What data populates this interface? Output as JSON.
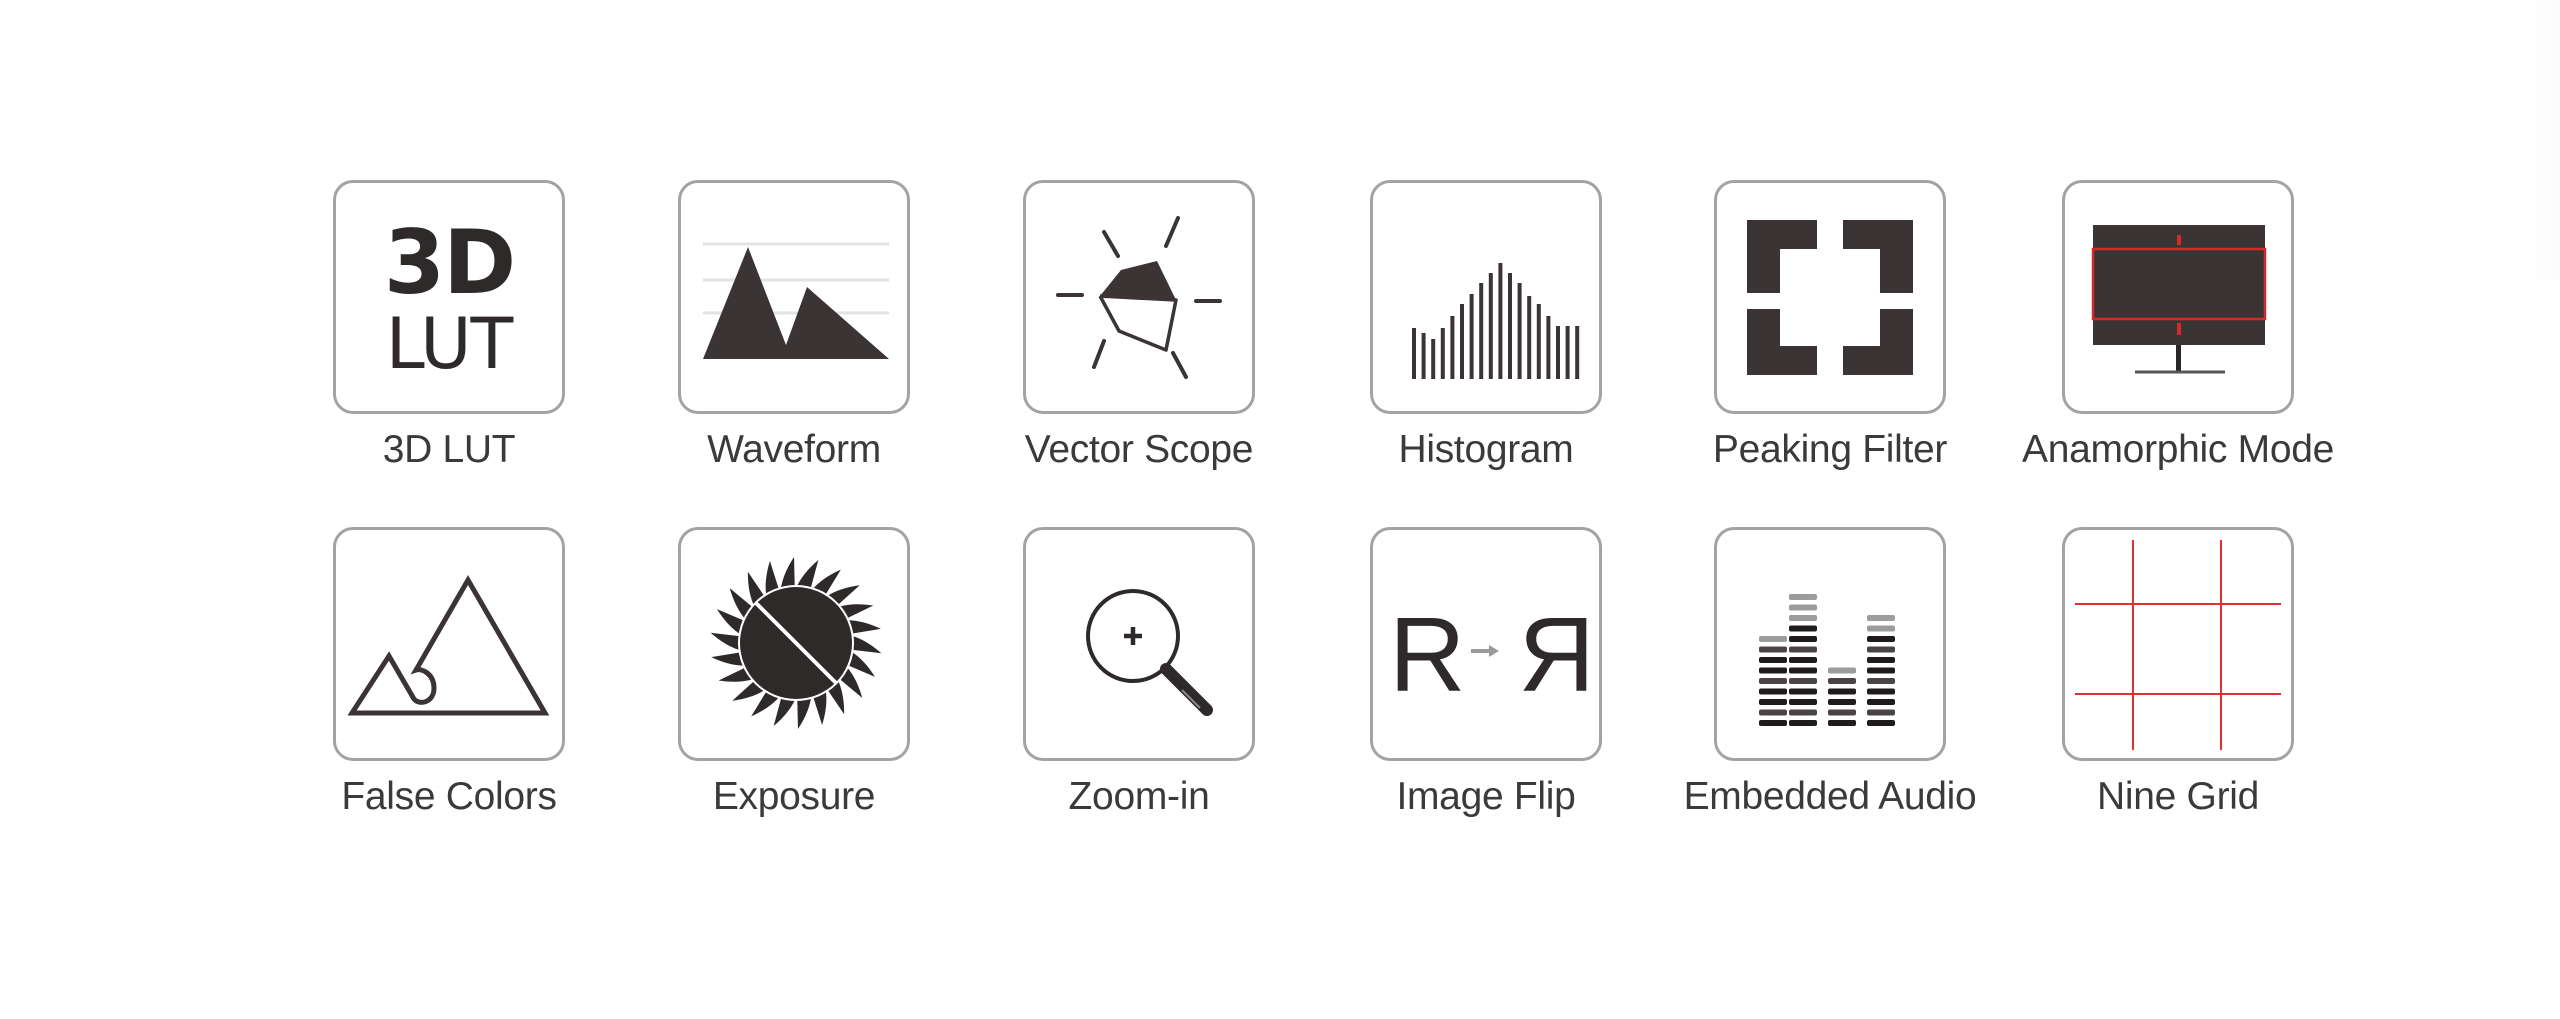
{
  "features": [
    {
      "label": "3D LUT",
      "icon": "lut-3d-icon",
      "glyph_top": "3D",
      "glyph_bottom": "LUT"
    },
    {
      "label": "Waveform",
      "icon": "waveform-icon"
    },
    {
      "label": "Vector Scope",
      "icon": "vector-scope-icon"
    },
    {
      "label": "Histogram",
      "icon": "histogram-icon"
    },
    {
      "label": "Peaking Filter",
      "icon": "peaking-filter-icon"
    },
    {
      "label": "Anamorphic Mode",
      "icon": "anamorphic-monitor-icon"
    },
    {
      "label": "False Colors",
      "icon": "mountains-icon"
    },
    {
      "label": "Exposure",
      "icon": "sun-icon"
    },
    {
      "label": "Zoom-in",
      "icon": "magnifier-plus-icon"
    },
    {
      "label": "Image Flip",
      "icon": "image-flip-icon",
      "glyph_left": "R",
      "glyph_right": "R"
    },
    {
      "label": "Embedded Audio",
      "icon": "audio-meter-icon"
    },
    {
      "label": "Nine Grid",
      "icon": "nine-grid-icon"
    }
  ],
  "colors": {
    "icon_fill": "#3a3434",
    "tile_border": "#a3a3a3",
    "label_text": "#3a3a3a",
    "guide_red": "#e0302f",
    "arrow_gray": "#9a9a9a"
  }
}
